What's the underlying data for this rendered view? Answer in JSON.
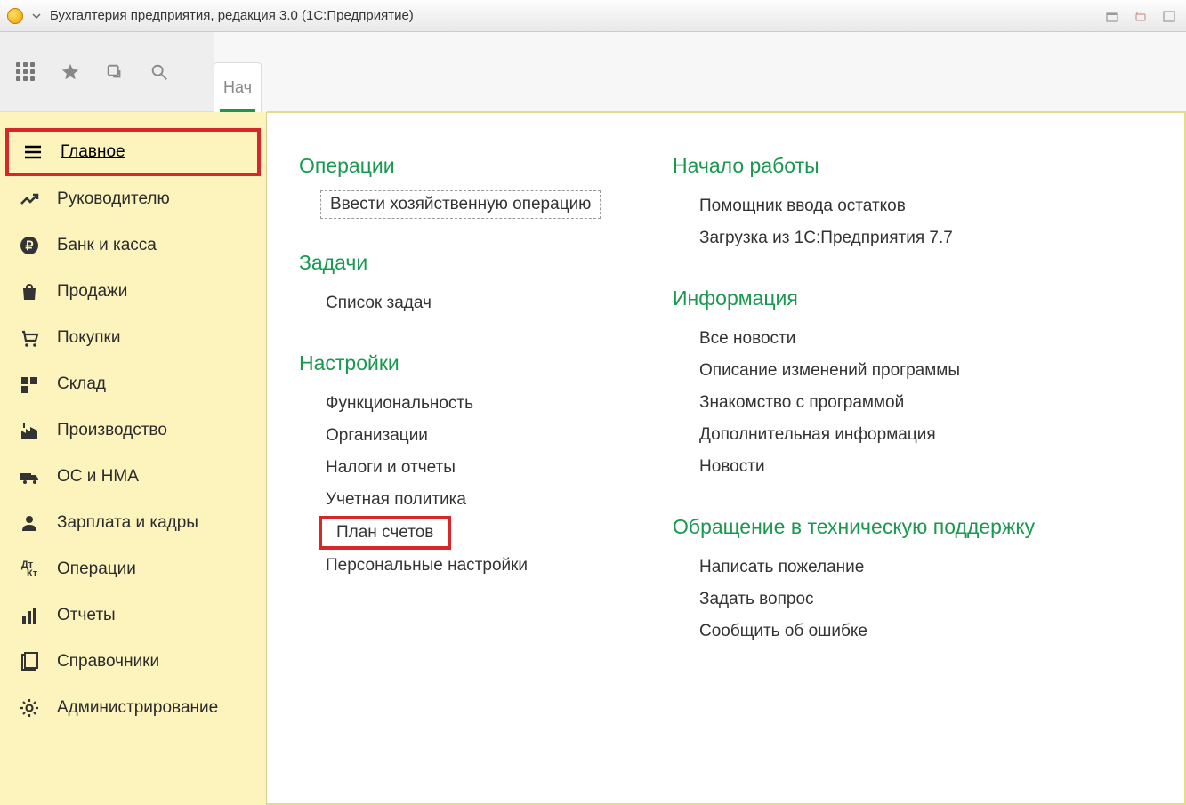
{
  "window": {
    "title": "Бухгалтерия предприятия, редакция 3.0  (1С:Предприятие)"
  },
  "tabs": {
    "first_label": "Нач"
  },
  "sidebar": {
    "items": [
      {
        "label": "Главное",
        "icon": "menu"
      },
      {
        "label": "Руководителю",
        "icon": "chart"
      },
      {
        "label": "Банк и касса",
        "icon": "ruble"
      },
      {
        "label": "Продажи",
        "icon": "bag"
      },
      {
        "label": "Покупки",
        "icon": "cart"
      },
      {
        "label": "Склад",
        "icon": "boxes"
      },
      {
        "label": "Производство",
        "icon": "factory"
      },
      {
        "label": "ОС и НМА",
        "icon": "truck"
      },
      {
        "label": "Зарплата и кадры",
        "icon": "person"
      },
      {
        "label": "Операции",
        "icon": "dtkt"
      },
      {
        "label": "Отчеты",
        "icon": "bars"
      },
      {
        "label": "Справочники",
        "icon": "books"
      },
      {
        "label": "Администрирование",
        "icon": "gear"
      }
    ]
  },
  "content": {
    "col1": {
      "s1_title": "Операции",
      "s1_link1": "Ввести хозяйственную операцию",
      "s2_title": "Задачи",
      "s2_link1": "Список задач",
      "s3_title": "Настройки",
      "s3_link1": "Функциональность",
      "s3_link2": "Организации",
      "s3_link3": "Налоги и отчеты",
      "s3_link4": "Учетная политика",
      "s3_link5": "План счетов",
      "s3_link6": "Персональные настройки"
    },
    "col2": {
      "s1_title": "Начало работы",
      "s1_link1": "Помощник ввода остатков",
      "s1_link2": "Загрузка из 1С:Предприятия 7.7",
      "s2_title": "Информация",
      "s2_link1": "Все новости",
      "s2_link2": "Описание изменений программы",
      "s2_link3": "Знакомство с программой",
      "s2_link4": "Дополнительная информация",
      "s2_link5": "Новости",
      "s3_title": "Обращение в техническую поддержку",
      "s3_link1": "Написать пожелание",
      "s3_link2": "Задать вопрос",
      "s3_link3": "Сообщить об ошибке"
    }
  }
}
